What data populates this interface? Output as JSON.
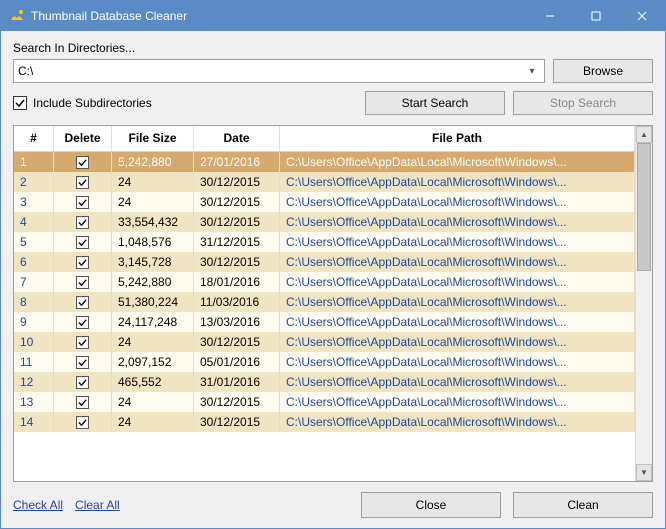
{
  "window": {
    "title": "Thumbnail Database Cleaner"
  },
  "search": {
    "label": "Search In Directories...",
    "value": "C:\\",
    "browse": "Browse",
    "include_sub": "Include Subdirectories",
    "include_sub_checked": true,
    "start": "Start Search",
    "stop": "Stop Search"
  },
  "table": {
    "headers": {
      "num": "#",
      "delete": "Delete",
      "size": "File Size",
      "date": "Date",
      "path": "File Path"
    },
    "rows": [
      {
        "n": "1",
        "del": true,
        "size": "5,242,880",
        "date": "27/01/2016",
        "path": "C:\\Users\\Office\\AppData\\Local\\Microsoft\\Windows\\...",
        "sel": true
      },
      {
        "n": "2",
        "del": true,
        "size": "24",
        "date": "30/12/2015",
        "path": "C:\\Users\\Office\\AppData\\Local\\Microsoft\\Windows\\..."
      },
      {
        "n": "3",
        "del": true,
        "size": "24",
        "date": "30/12/2015",
        "path": "C:\\Users\\Office\\AppData\\Local\\Microsoft\\Windows\\..."
      },
      {
        "n": "4",
        "del": true,
        "size": "33,554,432",
        "date": "30/12/2015",
        "path": "C:\\Users\\Office\\AppData\\Local\\Microsoft\\Windows\\..."
      },
      {
        "n": "5",
        "del": true,
        "size": "1,048,576",
        "date": "31/12/2015",
        "path": "C:\\Users\\Office\\AppData\\Local\\Microsoft\\Windows\\..."
      },
      {
        "n": "6",
        "del": true,
        "size": "3,145,728",
        "date": "30/12/2015",
        "path": "C:\\Users\\Office\\AppData\\Local\\Microsoft\\Windows\\..."
      },
      {
        "n": "7",
        "del": true,
        "size": "5,242,880",
        "date": "18/01/2016",
        "path": "C:\\Users\\Office\\AppData\\Local\\Microsoft\\Windows\\..."
      },
      {
        "n": "8",
        "del": true,
        "size": "51,380,224",
        "date": "11/03/2016",
        "path": "C:\\Users\\Office\\AppData\\Local\\Microsoft\\Windows\\..."
      },
      {
        "n": "9",
        "del": true,
        "size": "24,117,248",
        "date": "13/03/2016",
        "path": "C:\\Users\\Office\\AppData\\Local\\Microsoft\\Windows\\..."
      },
      {
        "n": "10",
        "del": true,
        "size": "24",
        "date": "30/12/2015",
        "path": "C:\\Users\\Office\\AppData\\Local\\Microsoft\\Windows\\..."
      },
      {
        "n": "11",
        "del": true,
        "size": "2,097,152",
        "date": "05/01/2016",
        "path": "C:\\Users\\Office\\AppData\\Local\\Microsoft\\Windows\\..."
      },
      {
        "n": "12",
        "del": true,
        "size": "465,552",
        "date": "31/01/2016",
        "path": "C:\\Users\\Office\\AppData\\Local\\Microsoft\\Windows\\..."
      },
      {
        "n": "13",
        "del": true,
        "size": "24",
        "date": "30/12/2015",
        "path": "C:\\Users\\Office\\AppData\\Local\\Microsoft\\Windows\\..."
      },
      {
        "n": "14",
        "del": true,
        "size": "24",
        "date": "30/12/2015",
        "path": "C:\\Users\\Office\\AppData\\Local\\Microsoft\\Windows\\..."
      }
    ]
  },
  "footer": {
    "check_all": "Check All",
    "clear_all": "Clear All",
    "close": "Close",
    "clean": "Clean"
  }
}
